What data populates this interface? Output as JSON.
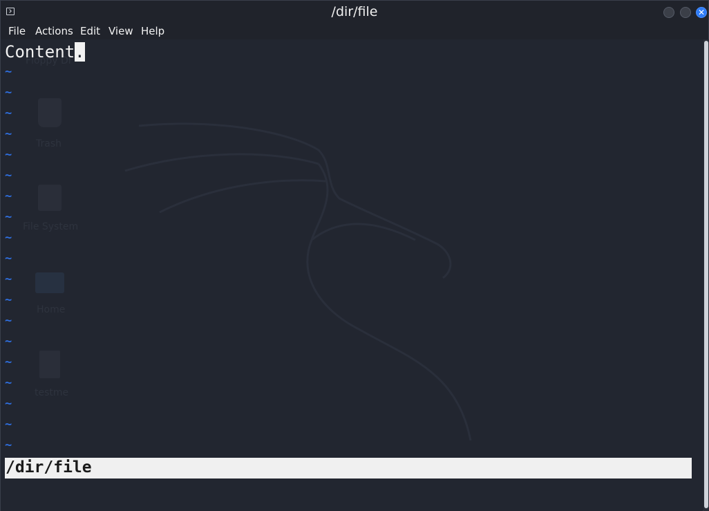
{
  "window": {
    "title": "/dir/file",
    "close_symbol": "✕",
    "icons": {
      "app": "terminal-icon",
      "minimize": "minimize-icon",
      "maximize": "maximize-icon",
      "close": "close-icon"
    }
  },
  "menu": {
    "items": [
      "File",
      "Actions",
      "Edit",
      "View",
      "Help"
    ]
  },
  "editor": {
    "content_line": "Content",
    "cursor_char": ".",
    "tilde": "~",
    "tilde_count": 19,
    "status_text": "/dir/file"
  },
  "desktop_background": {
    "labels": [
      "Floppy Di",
      "Trash",
      "File System",
      "Home",
      "testme"
    ],
    "icons": [
      "floppy-icon",
      "trash-icon",
      "drive-icon",
      "home-folder-icon",
      "file-icon"
    ]
  },
  "colors": {
    "background": "#222630",
    "tilde": "#2f6fe0",
    "status_bg": "#f0f0f0",
    "close_button": "#2f7cf6"
  }
}
